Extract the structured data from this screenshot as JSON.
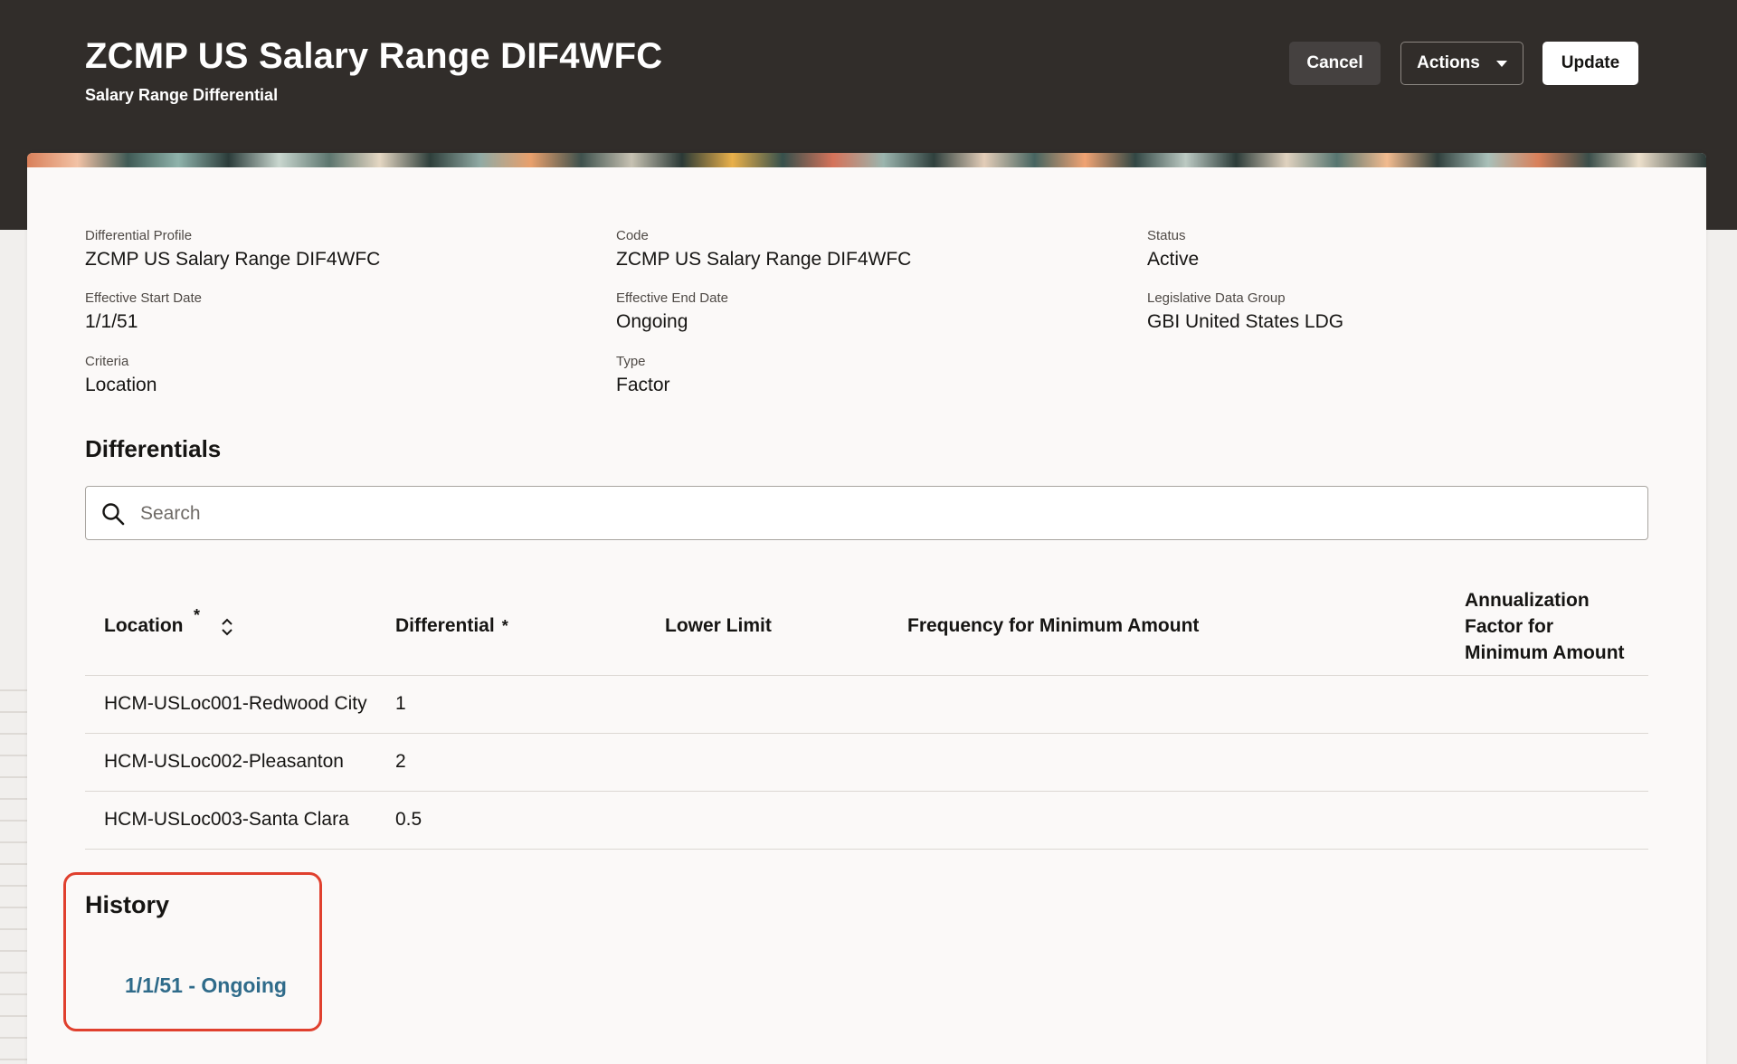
{
  "header": {
    "title": "ZCMP US Salary Range DIF4WFC",
    "subtitle": "Salary Range Differential",
    "buttons": {
      "cancel": "Cancel",
      "actions": "Actions",
      "update": "Update"
    }
  },
  "details": {
    "differential_profile": {
      "label": "Differential Profile",
      "value": "ZCMP US Salary Range DIF4WFC"
    },
    "code": {
      "label": "Code",
      "value": "ZCMP US Salary Range DIF4WFC"
    },
    "status": {
      "label": "Status",
      "value": "Active"
    },
    "effective_start_date": {
      "label": "Effective Start Date",
      "value": "1/1/51"
    },
    "effective_end_date": {
      "label": "Effective End Date",
      "value": "Ongoing"
    },
    "legislative_data_group": {
      "label": "Legislative Data Group",
      "value": "GBI United States LDG"
    },
    "criteria": {
      "label": "Criteria",
      "value": "Location"
    },
    "type": {
      "label": "Type",
      "value": "Factor"
    }
  },
  "differentials": {
    "title": "Differentials",
    "search": {
      "placeholder": "Search",
      "value": ""
    },
    "columns": {
      "location": "Location",
      "differential": "Differential",
      "lower_limit": "Lower Limit",
      "frequency_min": "Frequency for Minimum Amount",
      "annualization_line1": "Annualization",
      "annualization_line2": "Factor for",
      "annualization_line3": "Minimum Amount",
      "required_marker": "*"
    },
    "rows": [
      {
        "location": "HCM-USLoc001-Redwood City",
        "differential": "1"
      },
      {
        "location": "HCM-USLoc002-Pleasanton",
        "differential": "2"
      },
      {
        "location": "HCM-USLoc003-Santa Clara",
        "differential": "0.5"
      }
    ]
  },
  "history": {
    "title": "History",
    "link": "1/1/51 - Ongoing"
  },
  "colors": {
    "header_bg": "#312d2a",
    "card_bg": "#fbf9f8",
    "link": "#2f6b8a",
    "highlight": "#e0402e"
  }
}
